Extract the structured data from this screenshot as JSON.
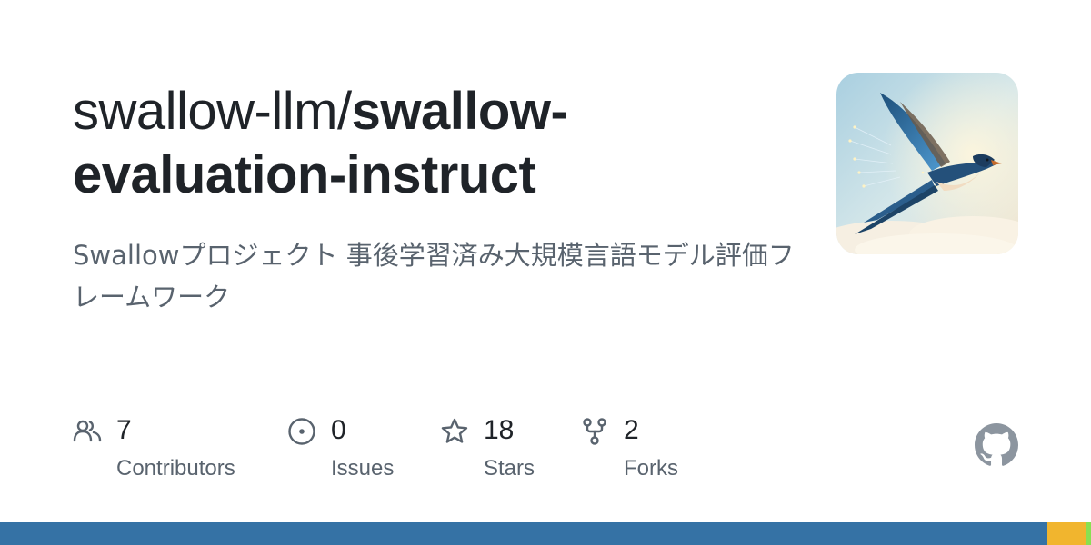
{
  "repo": {
    "owner": "swallow-llm/",
    "name": "swallow-evaluation-instruct",
    "description": "Swallowプロジェクト 事後学習済み大規模言語モデル評価フレームワーク"
  },
  "stats": [
    {
      "icon": "people-icon",
      "value": "7",
      "label": "Contributors"
    },
    {
      "icon": "issue-circle-icon",
      "value": "0",
      "label": "Issues"
    },
    {
      "icon": "star-icon",
      "value": "18",
      "label": "Stars"
    },
    {
      "icon": "fork-icon",
      "value": "2",
      "label": "Forks"
    }
  ],
  "language_bar": [
    {
      "color": "#3572A5",
      "share": 0.96
    },
    {
      "color": "#f1b52e",
      "share": 0.035
    },
    {
      "color": "#89e051",
      "share": 0.005
    }
  ],
  "colors": {
    "text": "#1f2328",
    "muted": "#59636e",
    "github_logo": "#8c959f"
  }
}
